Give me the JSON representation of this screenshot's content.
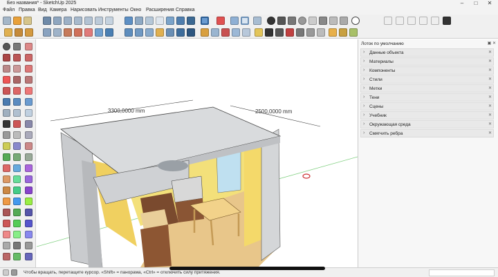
{
  "window": {
    "title": "Без названия* - SketchUp 2025"
  },
  "menu": [
    "Файл",
    "Правка",
    "Вид",
    "Камера",
    "Нарисовать",
    "Инструменты",
    "Окно",
    "Расширения",
    "Справка"
  ],
  "dimensions": {
    "width_label": "3300,0000 mm",
    "depth_label": "2500,0000 mm"
  },
  "tray": {
    "title": "Лоток по умолчанию",
    "panels": [
      "Данные объекта",
      "Материалы",
      "Компоненты",
      "Стили",
      "Метки",
      "Тени",
      "Сцены",
      "Учебник",
      "Окружающая среда",
      "Смягчить ребра"
    ]
  },
  "status": {
    "text": "Чтобы вращать, перетащите курсор. «Shift» = панорама, «Ctrl» = отключить силу притяжения."
  }
}
